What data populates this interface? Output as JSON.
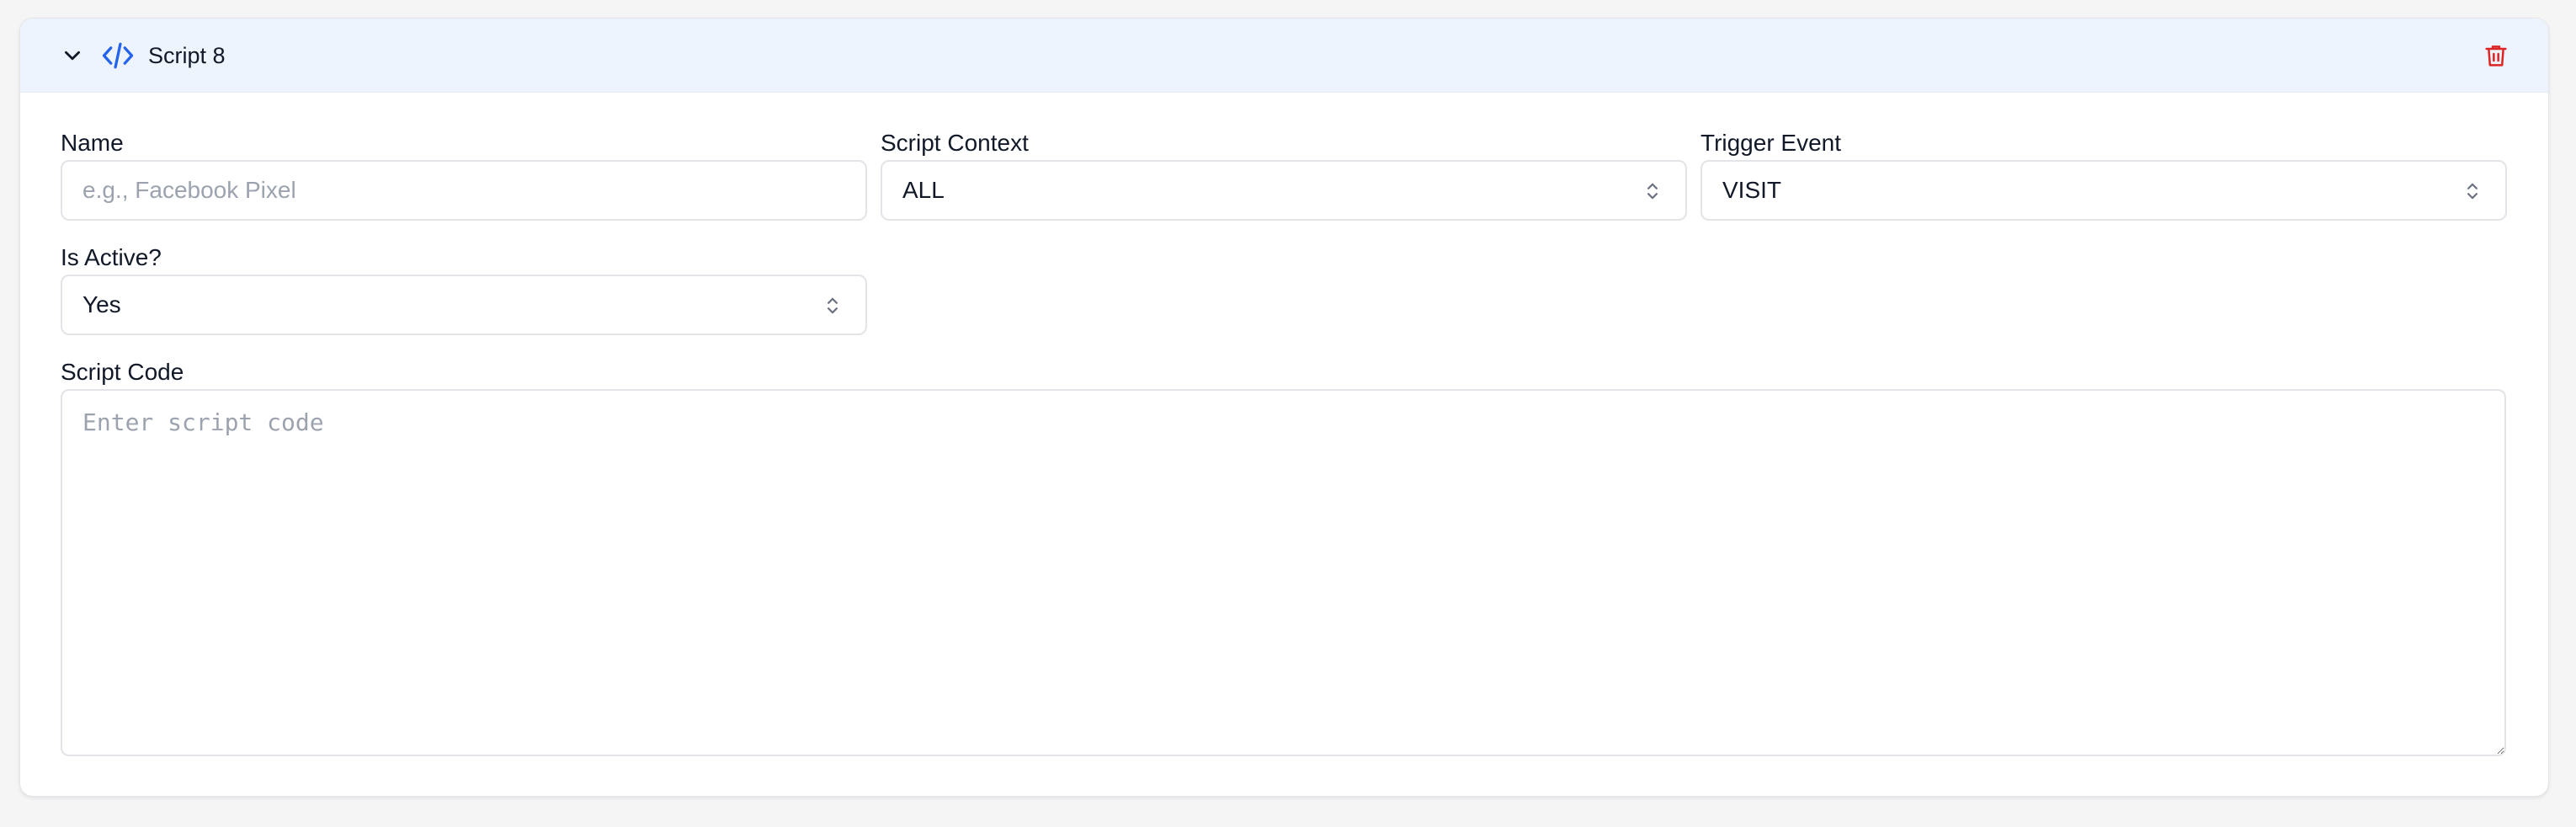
{
  "header": {
    "title": "Script 8",
    "icons": {
      "collapse": "chevron-down-icon",
      "script": "code-icon",
      "delete": "trash-icon"
    }
  },
  "form": {
    "name": {
      "label": "Name",
      "value": "",
      "placeholder": "e.g., Facebook Pixel"
    },
    "script_context": {
      "label": "Script Context",
      "value": "ALL"
    },
    "trigger_event": {
      "label": "Trigger Event",
      "value": "VISIT"
    },
    "is_active": {
      "label": "Is Active?",
      "value": "Yes"
    },
    "script_code": {
      "label": "Script Code",
      "value": "",
      "placeholder": "Enter script code"
    }
  },
  "colors": {
    "header_bg": "#eef4fe",
    "accent": "#2563eb",
    "danger": "#dc2626",
    "border": "#e2e4e8",
    "text": "#111827",
    "placeholder": "#9ca3af"
  }
}
